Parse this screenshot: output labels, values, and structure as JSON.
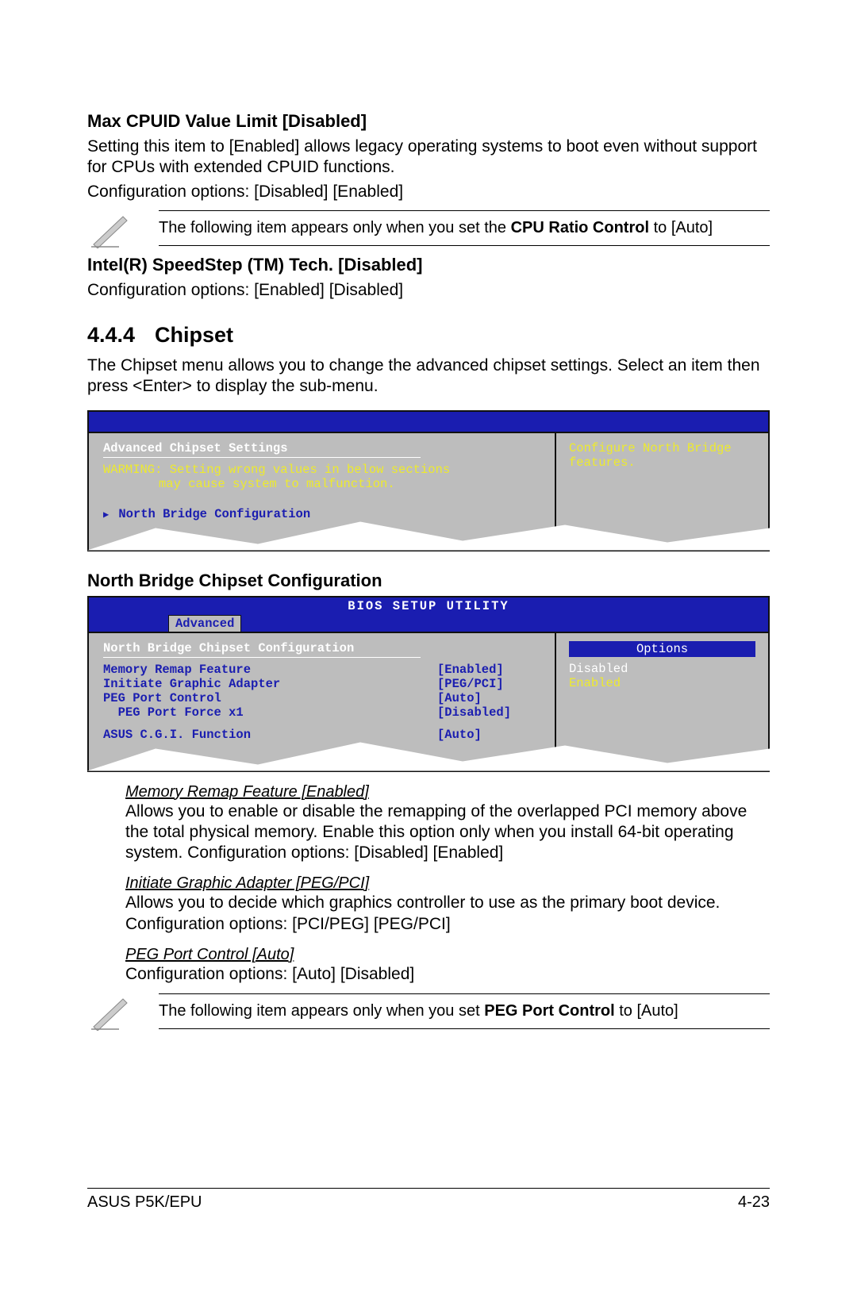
{
  "cpuid": {
    "heading": "Max CPUID Value Limit [Disabled]",
    "para": "Setting this item to [Enabled] allows legacy operating systems to boot even without support for CPUs with extended CPUID functions.",
    "config": "Configuration options: [Disabled] [Enabled]"
  },
  "note1_pre": "The following item appears only when you set the ",
  "note1_bold": "CPU Ratio Control",
  "note1_post": " to [Auto]",
  "speedstep": {
    "heading": "Intel(R) SpeedStep (TM) Tech. [Disabled]",
    "config": "Configuration options: [Enabled] [Disabled]"
  },
  "chipset": {
    "num": "4.4.4",
    "title": "Chipset",
    "para": "The Chipset menu allows you to change the advanced chipset settings. Select an item then press <Enter> to display the sub-menu."
  },
  "bios1": {
    "title": "Advanced Chipset Settings",
    "warn1": "WARMING: Setting wrong values in below sections",
    "warn2": "may cause system to malfunction.",
    "item1": "North Bridge Configuration",
    "help": "Configure North Bridge features."
  },
  "nbc_heading": "North Bridge Chipset Configuration",
  "bios2": {
    "util_title": "BIOS SETUP UTILITY",
    "tab": "Advanced",
    "title": "North Bridge Chipset Configuration",
    "items": [
      {
        "label": "Memory Remap Feature",
        "value": "[Enabled]"
      },
      {
        "label": "Initiate Graphic Adapter",
        "value": "[PEG/PCI]"
      },
      {
        "label": "PEG Port Control",
        "value": "[Auto]"
      },
      {
        "label": "  PEG Port Force x1",
        "value": "[Disabled]"
      }
    ],
    "item_last": {
      "label": "ASUS C.G.I. Function",
      "value": "[Auto]"
    },
    "opt_header": "Options",
    "opt1": "Disabled",
    "opt2": "Enabled"
  },
  "desc1": {
    "title": "Memory Remap Feature [Enabled]",
    "body": "Allows you to enable or disable the remapping of the overlapped PCI memory above the total physical memory. Enable this option only when you install 64-bit operating system. Configuration options: [Disabled] [Enabled]"
  },
  "desc2": {
    "title": "Initiate Graphic Adapter [PEG/PCI]",
    "body": "Allows you to decide which graphics controller to use as the primary boot device. Configuration options: [PCI/PEG] [PEG/PCI]"
  },
  "desc3": {
    "title": "PEG Port Control [Auto]",
    "body": "Configuration options: [Auto] [Disabled]"
  },
  "note2_pre": "The following item appears only when you set ",
  "note2_bold": "PEG Port Control",
  "note2_post": " to [Auto]",
  "footer_left": "ASUS P5K/EPU",
  "footer_right": "4-23"
}
